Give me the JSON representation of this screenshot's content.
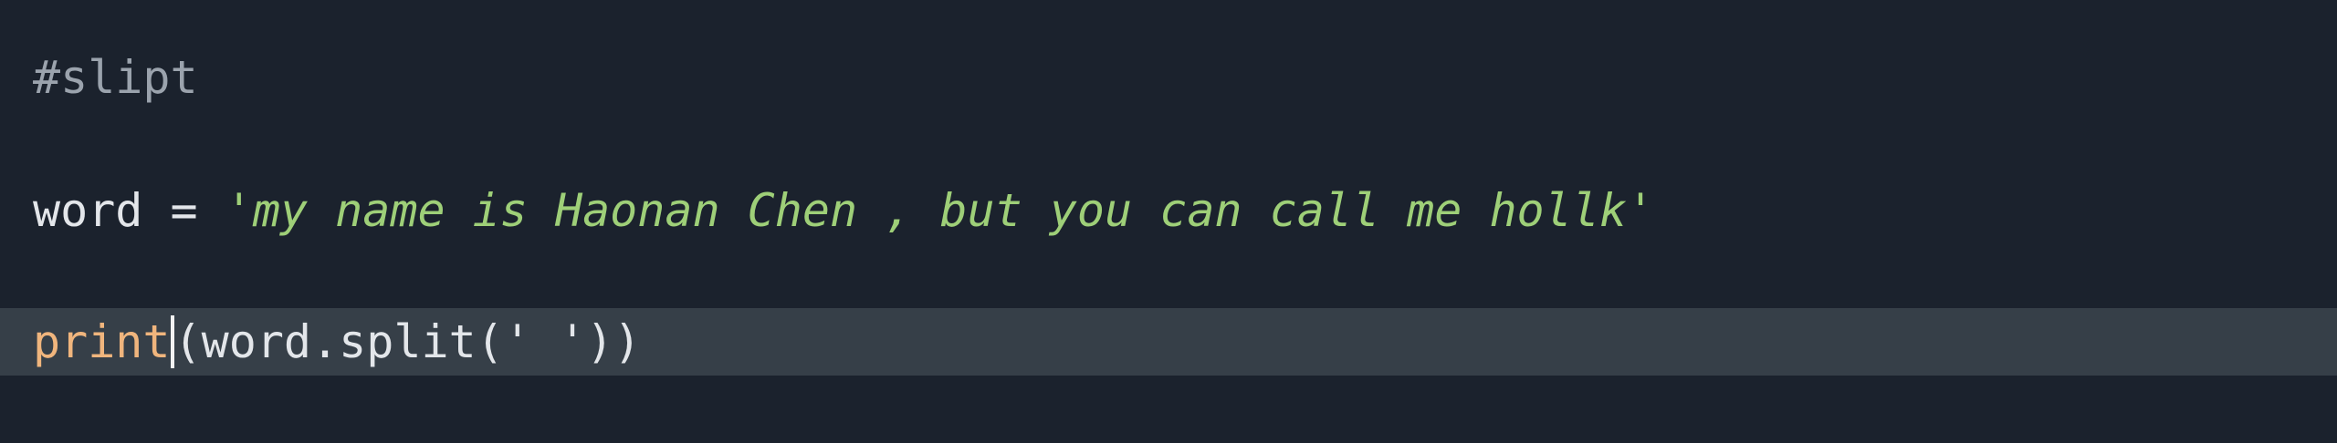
{
  "editor": {
    "lines": [
      {
        "tokens": [
          {
            "type": "comment",
            "text": "#slipt"
          }
        ]
      },
      {
        "tokens": [
          {
            "type": "ident",
            "text": "word"
          },
          {
            "type": "op",
            "text": " = "
          },
          {
            "type": "string",
            "text": "'my name is Haonan Chen , but you can call me hollk'"
          }
        ]
      },
      {
        "tokens": [
          {
            "type": "builtin",
            "text": "print"
          },
          {
            "type": "punct",
            "text": "(word.split(' '))"
          }
        ]
      }
    ]
  },
  "colors": {
    "background": "#1b222d",
    "current_line": "#363f48",
    "comment": "#9ba3ad",
    "string": "#9ecf78",
    "builtin": "#f0b57d",
    "text": "#e3e6ea"
  }
}
